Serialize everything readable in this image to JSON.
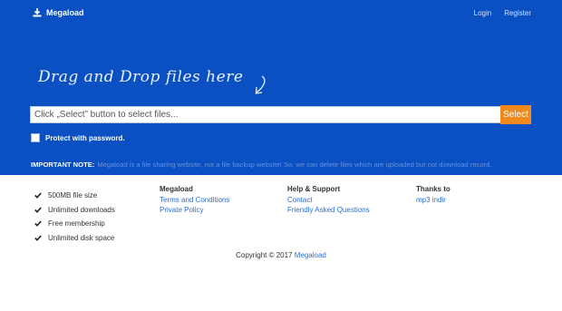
{
  "header": {
    "brand": "Megaload",
    "nav": {
      "login": "Login",
      "register": "Register"
    }
  },
  "hero": {
    "drag_text": "Drag and Drop files here",
    "input_placeholder": "Click „Select” button to select files...",
    "select_label": "Select",
    "protect_label": "Protect with password.",
    "note_label": "IMPORTANT NOTE:",
    "note_text": "Megaload is a file sharing website, not a file backup website! So, we can delete files which are uploaded but not download record."
  },
  "features": [
    "500MB file size",
    "Unlimited downloads",
    "Free membership",
    "Unlimited disk space"
  ],
  "footer": {
    "col1": {
      "title": "Megaload",
      "links": [
        "Terms and Conditions",
        "Private Policy"
      ]
    },
    "col2": {
      "title": "Help & Support",
      "links": [
        "Contact",
        "Friendly Asked Questions"
      ]
    },
    "col3": {
      "title": "Thanks to",
      "links": [
        "mp3 indir"
      ]
    },
    "copyright_text": "Copyright © 2017",
    "copyright_link": "Megaload"
  },
  "colors": {
    "hero": "#0a50c2",
    "accent": "#f08a1c",
    "link": "#2a6fd6"
  },
  "icons": [
    "download-tray-icon",
    "curved-arrow-icon",
    "checkmark-icon"
  ]
}
